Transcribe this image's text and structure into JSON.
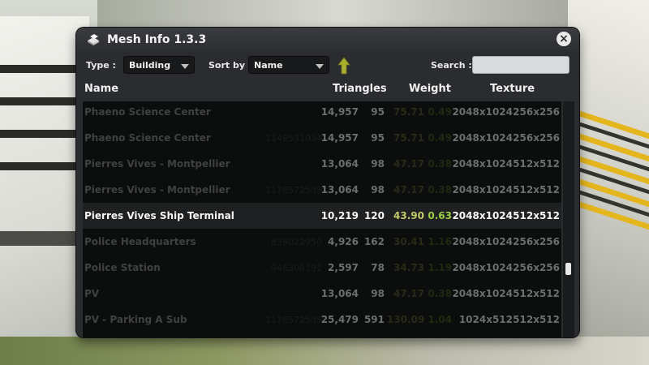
{
  "window": {
    "title": "Mesh Info 1.3.3",
    "close_icon": "close-icon"
  },
  "filters": {
    "type_label": "Type :",
    "type_value": "Building",
    "sort_label": "Sort by :",
    "sort_value": "Name",
    "sort_direction_icon": "arrow-up-icon",
    "search_label": "Search :",
    "search_value": ""
  },
  "columns": {
    "name": "Name",
    "triangles": "Triangles",
    "weight": "Weight",
    "texture": "Texture"
  },
  "rows": [
    {
      "name": "Phaeno Science Center",
      "id": "",
      "triangles": "14,957",
      "lod": "95",
      "weight": "75.71",
      "weight2": "0.49",
      "texture": "2048x1024",
      "lod_texture": "256x256",
      "selected": false
    },
    {
      "name": "Phaeno Science Center",
      "id": "1149531034",
      "triangles": "14,957",
      "lod": "95",
      "weight": "75.71",
      "weight2": "0.49",
      "texture": "2048x1024",
      "lod_texture": "256x256",
      "selected": false
    },
    {
      "name": "Pierres Vives - Montpellier",
      "id": "",
      "triangles": "13,064",
      "lod": "98",
      "weight": "47.17",
      "weight2": "0.38",
      "texture": "2048x1024",
      "lod_texture": "512x512",
      "selected": false
    },
    {
      "name": "Pierres Vives - Montpellier",
      "id": "1176572535",
      "triangles": "13,064",
      "lod": "98",
      "weight": "47.17",
      "weight2": "0.38",
      "texture": "2048x1024",
      "lod_texture": "512x512",
      "selected": false
    },
    {
      "name": "Pierres Vives Ship Terminal",
      "id": "",
      "triangles": "10,219",
      "lod": "120",
      "weight": "43.90",
      "weight2": "0.63",
      "texture": "2048x1024",
      "lod_texture": "512x512",
      "selected": true
    },
    {
      "name": "Police Headquarters",
      "id": "839022950",
      "triangles": "4,926",
      "lod": "162",
      "weight": "30.41",
      "weight2": "1.16",
      "texture": "2048x1024",
      "lod_texture": "256x256",
      "selected": false
    },
    {
      "name": "Police Station",
      "id": "946306191",
      "triangles": "2,597",
      "lod": "78",
      "weight": "34.73",
      "weight2": "1.19",
      "texture": "2048x1024",
      "lod_texture": "256x256",
      "selected": false
    },
    {
      "name": "PV",
      "id": "",
      "triangles": "13,064",
      "lod": "98",
      "weight": "47.17",
      "weight2": "0.38",
      "texture": "2048x1024",
      "lod_texture": "512x512",
      "selected": false
    },
    {
      "name": "PV - Parking A Sub",
      "id": "1176572535",
      "triangles": "25,479",
      "lod": "591",
      "weight": "130.09",
      "weight2": "1.04",
      "texture": "1024x512",
      "lod_texture": "512x512",
      "selected": false
    }
  ],
  "scroll": {
    "position_fraction": 0.72
  },
  "colors": {
    "panel_bg": "#2a2c2f",
    "list_bg": "#0c0d0d",
    "weight_highlight": "#c3c969",
    "weight2_highlight": "#9ccb45",
    "sort_arrow": "#a9b030",
    "world_yellow": "#e4b51c"
  }
}
